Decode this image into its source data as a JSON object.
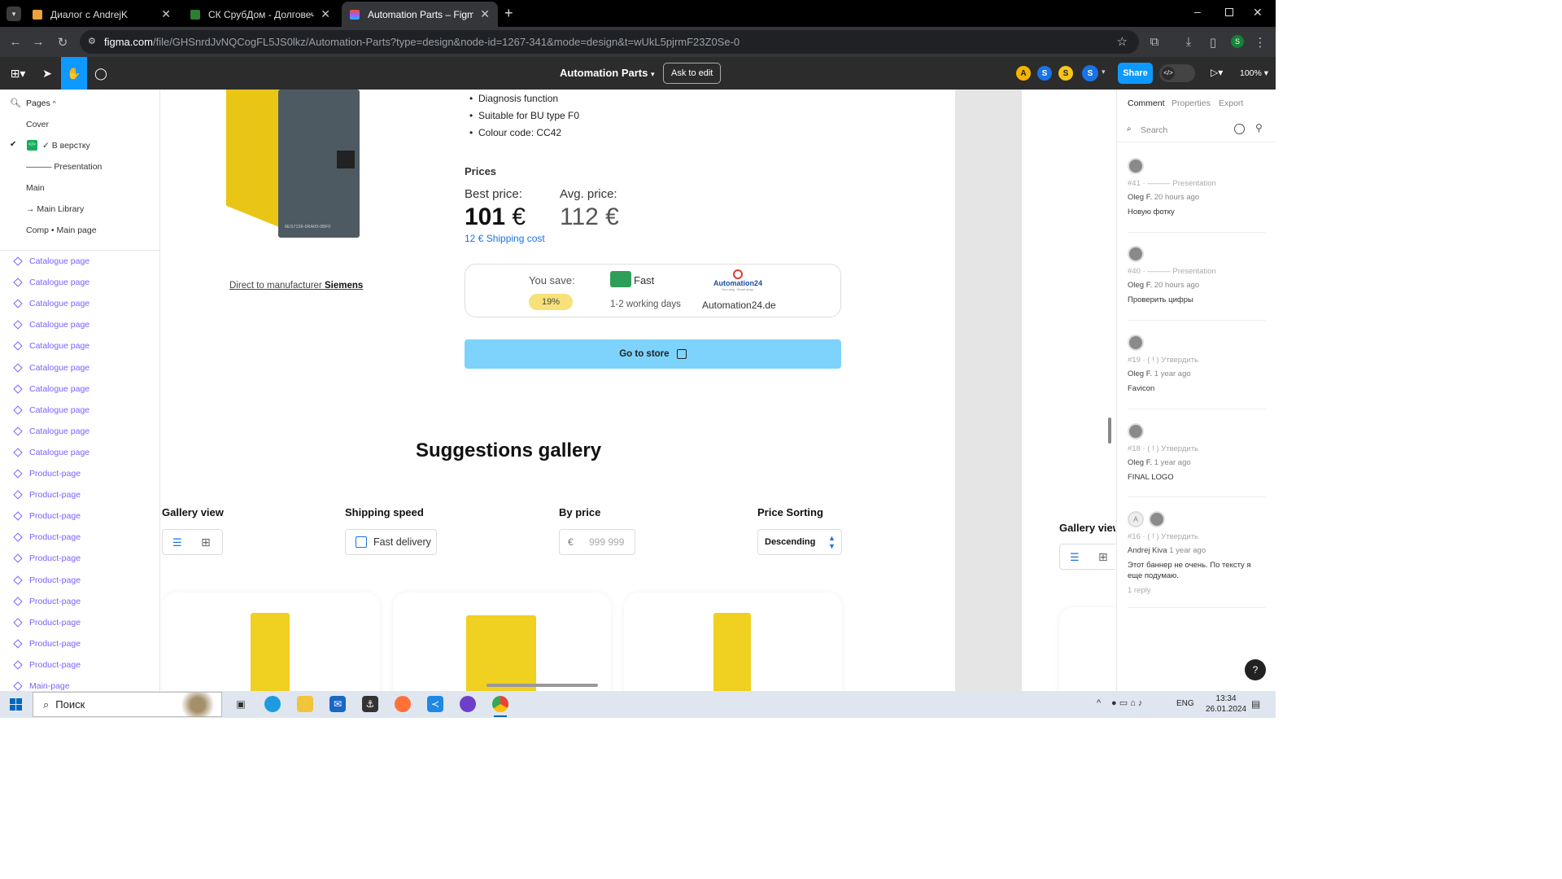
{
  "browser": {
    "tabs": [
      {
        "title": "Диалог с AndrejK",
        "active": false
      },
      {
        "title": "СК СрубДом - Долговечные д",
        "active": false
      },
      {
        "title": "Automation Parts – Figma",
        "active": true
      }
    ],
    "url_domain": "figma.com",
    "url_path": "/file/GHSnrdJvNQCogFL5JS0lkz/Automation-Parts?type=design&node-id=1267-341&mode=design&t=wUkL5pjrmF23Z0Se-0"
  },
  "figma": {
    "file_title": "Automation Parts",
    "ask_to_edit": "Ask to edit",
    "share": "Share",
    "zoom": "100%",
    "avatars": [
      {
        "letter": "A",
        "color": "#f5b400"
      },
      {
        "letter": "S",
        "color": "#1a73e8"
      },
      {
        "letter": "S",
        "color": "#f5c518"
      },
      {
        "letter": "S",
        "color": "#1a73e8"
      }
    ]
  },
  "left_panel": {
    "pages_label": "Pages",
    "pages": [
      "Cover",
      "✓ В верстку",
      "——— Presentation",
      "Main",
      "→ Main Library",
      "Comp • Main page"
    ],
    "layers": [
      "Catalogue page",
      "Catalogue page",
      "Catalogue page",
      "Catalogue page",
      "Catalogue page",
      "Catalogue page",
      "Catalogue page",
      "Catalogue page",
      "Catalogue page",
      "Catalogue page",
      "Product-page",
      "Product-page",
      "Product-page",
      "Product-page",
      "Product-page",
      "Product-page",
      "Product-page",
      "Product-page",
      "Product-page",
      "Product-page",
      "Main-page"
    ]
  },
  "product": {
    "features": [
      "Diagnosis function",
      "Suitable for BU type F0",
      "Colour code: CC42"
    ],
    "manufacturer_prefix": "Direct to manufacturer ",
    "manufacturer": "Siemens",
    "prices_title": "Prices",
    "best_label": "Best price:",
    "best_value": "101",
    "avg_label": "Avg. price:",
    "avg_value": "112",
    "currency": "€",
    "shipping_value": "12 €",
    "shipping_label": "Shipping cost",
    "you_save": "You save:",
    "save_pct": "19%",
    "fast": "Fast",
    "working_days": "1-2 working days",
    "store_logo": "Automation24",
    "store_tagline": "One stop. Smart shop.",
    "store_name": "Automation24.de",
    "go_to_store": "Go to store",
    "module_label": "6ES7136-6RA00-0BF0"
  },
  "gallery": {
    "title": "Suggestions gallery",
    "gallery_view": "Gallery view",
    "shipping_speed": "Shipping speed",
    "fast_delivery": "Fast delivery",
    "by_price": "By price",
    "price_currency": "€",
    "price_placeholder": "999 999",
    "price_sorting": "Price Sorting",
    "sort_value": "Descending",
    "gallery_view_2": "Gallery view"
  },
  "comments": {
    "tabs": [
      "Comment",
      "Properties",
      "Export"
    ],
    "search_placeholder": "Search",
    "items": [
      {
        "meta": "#41 · ——— Presentation",
        "author": "Oleg F.",
        "time": "20 hours ago",
        "text": "Новую фотку"
      },
      {
        "meta": "#40 · ——— Presentation",
        "author": "Oleg F.",
        "time": "20 hours ago",
        "text": "Проверить цифры"
      },
      {
        "meta": "#19 · ( ! ) Утвердить",
        "author": "Oleg F.",
        "time": "1 year ago",
        "text": "Favicon"
      },
      {
        "meta": "#18 · ( ! ) Утвердить",
        "author": "Oleg F.",
        "time": "1 year ago",
        "text": "FINAL LOGO"
      },
      {
        "meta": "#16 · ( ! ) Утвердить",
        "author": "Andrej Kiva",
        "time": "1 year ago",
        "text": "Этот баннер не очень. По тексту я еще подумаю.",
        "replies": "1 reply"
      }
    ]
  },
  "taskbar": {
    "search": "Поиск",
    "lang": "ENG",
    "time": "13:34",
    "date": "26.01.2024"
  }
}
